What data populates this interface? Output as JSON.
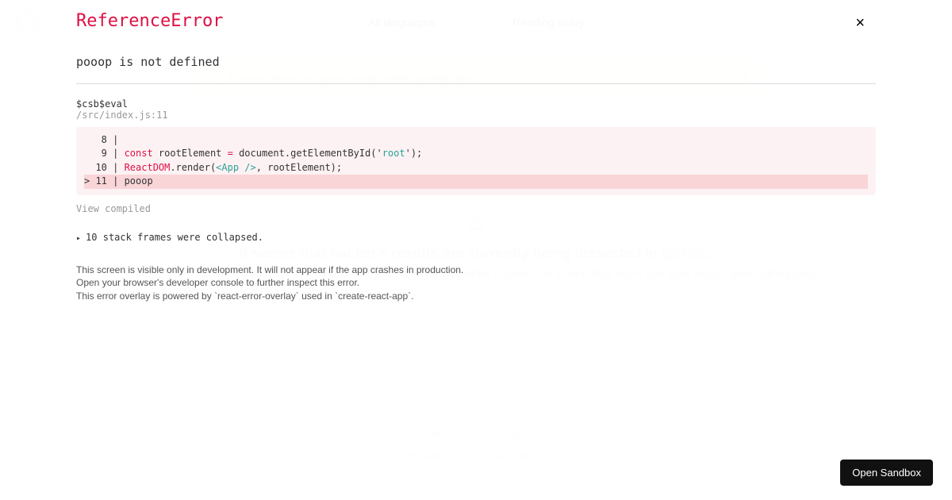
{
  "bg": {
    "select1": "All languages",
    "select2": "Trending today",
    "alert": "It seems there are some issues while loading data.",
    "empty_heading_prefix": "It seems that hacker's results are currently being dissected in ",
    "empty_heading_link": "GitHub",
    "empty_heading_suffix": ".",
    "empty_sub": "Have you tried going outside? Or you can check back later. Now would be a great time to write that novel you have always been talking about.",
    "made_prefix": "Made with ",
    "made_suffix": " in Singapore",
    "link1": "Send Feedback",
    "link2": "Clear Cache",
    "link3": "GitHub"
  },
  "error": {
    "title": "ReferenceError",
    "message": "pooop is not defined",
    "func": "$csb$eval",
    "path": "/src/index.js:11",
    "code": {
      "l8": "   8 | ",
      "l9_pre": "   9 | ",
      "l9_const": "const",
      "l9_mid": " rootElement ",
      "l9_eq": "=",
      "l9_after": " document.getElementById('",
      "l9_root": "root",
      "l9_end": "');",
      "l10_pre": "  10 | ",
      "l10_rd": "ReactDOM",
      "l10_render": ".render(",
      "l10_app": "<App />",
      "l10_tail": ", rootElement);",
      "l11": "> 11 | pooop"
    },
    "view_compiled": "View compiled",
    "collapsed": "10 stack frames were collapsed.",
    "footnote1": "This screen is visible only in development. It will not appear if the app crashes in production.",
    "footnote2": "Open your browser's developer console to further inspect this error.",
    "footnote3": "This error overlay is powered by `react-error-overlay` used in `create-react-app`."
  },
  "sandbox_button": "Open Sandbox"
}
